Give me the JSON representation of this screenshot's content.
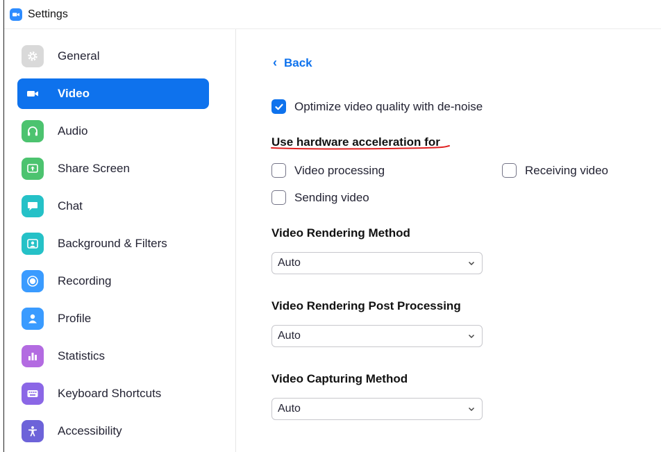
{
  "window": {
    "title": "Settings"
  },
  "sidebar": {
    "items": [
      {
        "label": "General",
        "icon": "gear-icon",
        "color": "#d9d9d9"
      },
      {
        "label": "Video",
        "icon": "video-camera-icon",
        "color": "#0e72ed",
        "active": true
      },
      {
        "label": "Audio",
        "icon": "headphones-icon",
        "color": "#4cc36f"
      },
      {
        "label": "Share Screen",
        "icon": "share-screen-icon",
        "color": "#4cc36f"
      },
      {
        "label": "Chat",
        "icon": "chat-bubble-icon",
        "color": "#25c1c7"
      },
      {
        "label": "Background & Filters",
        "icon": "background-icon",
        "color": "#25c1c7"
      },
      {
        "label": "Recording",
        "icon": "record-icon",
        "color": "#3a9bff"
      },
      {
        "label": "Profile",
        "icon": "profile-icon",
        "color": "#3a9bff"
      },
      {
        "label": "Statistics",
        "icon": "statistics-icon",
        "color": "#b36be1"
      },
      {
        "label": "Keyboard Shortcuts",
        "icon": "keyboard-icon",
        "color": "#8b67e6"
      },
      {
        "label": "Accessibility",
        "icon": "accessibility-icon",
        "color": "#6d63d9"
      }
    ]
  },
  "main": {
    "back_label": "Back",
    "denoise": {
      "label": "Optimize video quality with de-noise",
      "checked": true
    },
    "hw_accel": {
      "title": "Use hardware acceleration for",
      "video_processing": {
        "label": "Video processing",
        "checked": false
      },
      "receiving_video": {
        "label": "Receiving video",
        "checked": false
      },
      "sending_video": {
        "label": "Sending video",
        "checked": false
      }
    },
    "rendering_method": {
      "title": "Video Rendering Method",
      "value": "Auto"
    },
    "post_processing": {
      "title": "Video Rendering Post Processing",
      "value": "Auto"
    },
    "capturing_method": {
      "title": "Video Capturing Method",
      "value": "Auto"
    }
  },
  "colors": {
    "accent": "#0e72ed",
    "annotation": "#e02020"
  }
}
